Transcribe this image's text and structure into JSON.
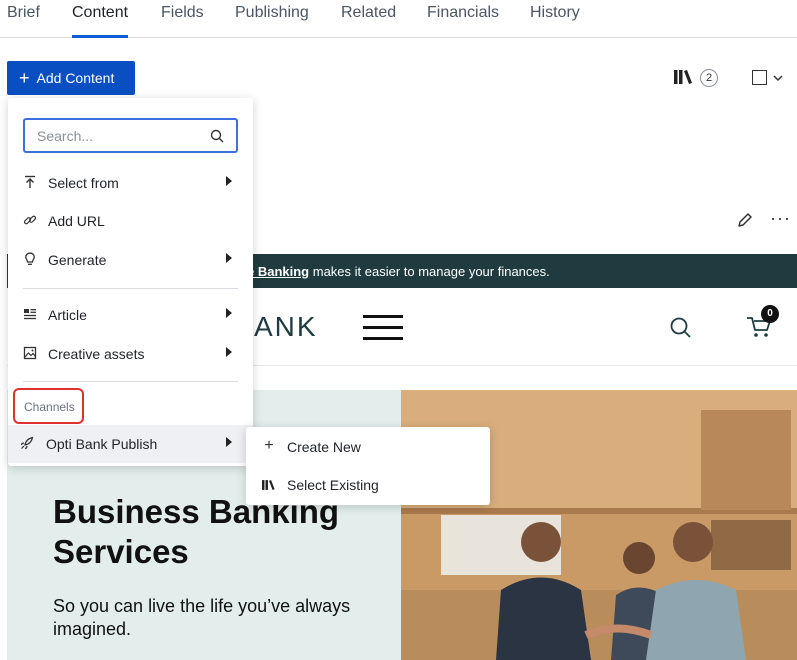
{
  "tabs": [
    {
      "label": "Brief"
    },
    {
      "label": "Content"
    },
    {
      "label": "Fields"
    },
    {
      "label": "Publishing"
    },
    {
      "label": "Related"
    },
    {
      "label": "Financials"
    },
    {
      "label": "History"
    }
  ],
  "active_tab": "Content",
  "add_button": {
    "label": "Add Content",
    "icon": "plus-icon"
  },
  "toolbar": {
    "library_count": "2",
    "library_icon": "library-icon",
    "select_icon": "checkbox-icon",
    "edit_icon": "pencil-icon",
    "more_icon": "more-horizontal-icon",
    "more_glyph": "···"
  },
  "menu": {
    "search_placeholder": "Search...",
    "items": [
      {
        "label": "Select from",
        "icon": "upload-icon",
        "has_submenu": true
      },
      {
        "label": "Add URL",
        "icon": "link-icon",
        "has_submenu": false
      },
      {
        "label": "Generate",
        "icon": "lightbulb-icon",
        "has_submenu": true
      },
      {
        "label": "Article",
        "icon": "article-icon",
        "has_submenu": true
      },
      {
        "label": "Creative assets",
        "icon": "image-icon",
        "has_submenu": true
      }
    ],
    "section_label": "Channels",
    "channel": {
      "label": "Opti Bank Publish",
      "icon": "rocket-icon",
      "has_submenu": true
    }
  },
  "submenu": {
    "items": [
      {
        "label": "Create New",
        "icon": "plus-icon",
        "glyph": "+"
      },
      {
        "label": "Select Existing",
        "icon": "library-icon"
      }
    ]
  },
  "preview": {
    "promo_bold": "e Banking",
    "promo_rest": " makes it easier to manage your finances.",
    "logo_partial": "ANK",
    "cart_count": "0",
    "hero_title": "Business Banking Services",
    "hero_subtitle": "So you can live the life you’ve always imagined."
  },
  "colors": {
    "accent": "#0a4fc1",
    "promo_bar": "#1f3b3f",
    "hero_bg": "#e3eeec",
    "highlight": "#e03131"
  }
}
